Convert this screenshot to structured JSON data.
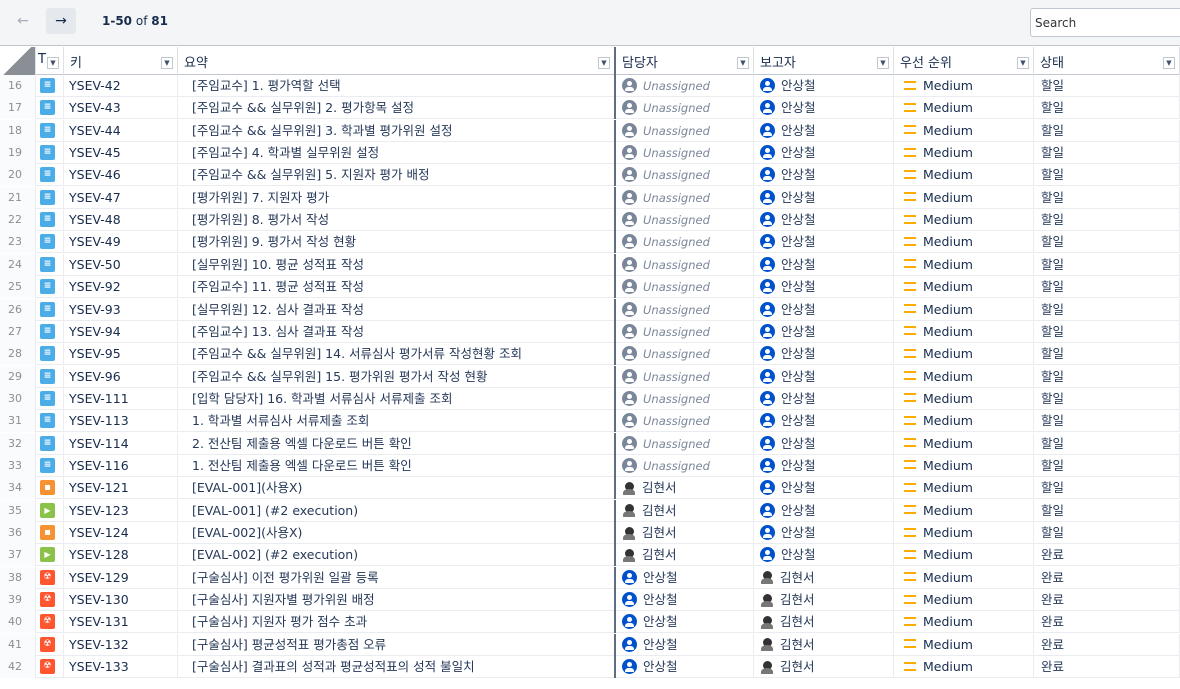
{
  "toolbar": {
    "prev_label": "←",
    "next_label": "→",
    "range": "1-50",
    "of_label": " of ",
    "total": "81",
    "search_placeholder": "Search"
  },
  "columns": {
    "type": "T",
    "key": "키",
    "summary": "요약",
    "assignee": "담당자",
    "reporter": "보고자",
    "priority": "우선 순위",
    "status": "상태"
  },
  "issues": [
    {
      "num": "16",
      "type": "story",
      "key": "YSEV-42",
      "summary": "[주임교수] 1. 평가역할 선택",
      "assignee": "Unassigned",
      "assignee_kind": "unassigned",
      "reporter": "안상철",
      "reporter_kind": "blue",
      "priority": "Medium",
      "status": "할일"
    },
    {
      "num": "17",
      "type": "story",
      "key": "YSEV-43",
      "summary": "[주임교수 && 실무위원] 2. 평가항목 설정",
      "assignee": "Unassigned",
      "assignee_kind": "unassigned",
      "reporter": "안상철",
      "reporter_kind": "blue",
      "priority": "Medium",
      "status": "할일"
    },
    {
      "num": "18",
      "type": "story",
      "key": "YSEV-44",
      "summary": "[주임교수 && 실무위원] 3. 학과별 평가위원 설정",
      "assignee": "Unassigned",
      "assignee_kind": "unassigned",
      "reporter": "안상철",
      "reporter_kind": "blue",
      "priority": "Medium",
      "status": "할일"
    },
    {
      "num": "19",
      "type": "story",
      "key": "YSEV-45",
      "summary": "[주임교수] 4. 학과별 실무위원 설정",
      "assignee": "Unassigned",
      "assignee_kind": "unassigned",
      "reporter": "안상철",
      "reporter_kind": "blue",
      "priority": "Medium",
      "status": "할일"
    },
    {
      "num": "20",
      "type": "story",
      "key": "YSEV-46",
      "summary": "[주임교수 && 실무위원] 5. 지원자 평가 배정",
      "assignee": "Unassigned",
      "assignee_kind": "unassigned",
      "reporter": "안상철",
      "reporter_kind": "blue",
      "priority": "Medium",
      "status": "할일"
    },
    {
      "num": "21",
      "type": "story",
      "key": "YSEV-47",
      "summary": "[평가위원] 7. 지원자 평가",
      "assignee": "Unassigned",
      "assignee_kind": "unassigned",
      "reporter": "안상철",
      "reporter_kind": "blue",
      "priority": "Medium",
      "status": "할일"
    },
    {
      "num": "22",
      "type": "story",
      "key": "YSEV-48",
      "summary": "[평가위원] 8. 평가서 작성",
      "assignee": "Unassigned",
      "assignee_kind": "unassigned",
      "reporter": "안상철",
      "reporter_kind": "blue",
      "priority": "Medium",
      "status": "할일"
    },
    {
      "num": "23",
      "type": "story",
      "key": "YSEV-49",
      "summary": "[평가위원] 9. 평가서 작성 현황",
      "assignee": "Unassigned",
      "assignee_kind": "unassigned",
      "reporter": "안상철",
      "reporter_kind": "blue",
      "priority": "Medium",
      "status": "할일"
    },
    {
      "num": "24",
      "type": "story",
      "key": "YSEV-50",
      "summary": "[실무위원] 10. 평균 성적표 작성",
      "assignee": "Unassigned",
      "assignee_kind": "unassigned",
      "reporter": "안상철",
      "reporter_kind": "blue",
      "priority": "Medium",
      "status": "할일"
    },
    {
      "num": "25",
      "type": "story",
      "key": "YSEV-92",
      "summary": "[주임교수] 11. 평균 성적표 작성",
      "assignee": "Unassigned",
      "assignee_kind": "unassigned",
      "reporter": "안상철",
      "reporter_kind": "blue",
      "priority": "Medium",
      "status": "할일"
    },
    {
      "num": "26",
      "type": "story",
      "key": "YSEV-93",
      "summary": "[실무위원] 12. 심사 결과표 작성",
      "assignee": "Unassigned",
      "assignee_kind": "unassigned",
      "reporter": "안상철",
      "reporter_kind": "blue",
      "priority": "Medium",
      "status": "할일"
    },
    {
      "num": "27",
      "type": "story",
      "key": "YSEV-94",
      "summary": "[주임교수] 13. 심사 결과표 작성",
      "assignee": "Unassigned",
      "assignee_kind": "unassigned",
      "reporter": "안상철",
      "reporter_kind": "blue",
      "priority": "Medium",
      "status": "할일"
    },
    {
      "num": "28",
      "type": "story",
      "key": "YSEV-95",
      "summary": "[주임교수 && 실무위원] 14. 서류심사 평가서류 작성현황 조회",
      "assignee": "Unassigned",
      "assignee_kind": "unassigned",
      "reporter": "안상철",
      "reporter_kind": "blue",
      "priority": "Medium",
      "status": "할일"
    },
    {
      "num": "29",
      "type": "story",
      "key": "YSEV-96",
      "summary": "[주임교수 && 실무위원] 15. 평가위원 평가서 작성 현황",
      "assignee": "Unassigned",
      "assignee_kind": "unassigned",
      "reporter": "안상철",
      "reporter_kind": "blue",
      "priority": "Medium",
      "status": "할일"
    },
    {
      "num": "30",
      "type": "story",
      "key": "YSEV-111",
      "summary": "[입학 담당자] 16. 학과별 서류심사 서류제출 조회",
      "assignee": "Unassigned",
      "assignee_kind": "unassigned",
      "reporter": "안상철",
      "reporter_kind": "blue",
      "priority": "Medium",
      "status": "할일"
    },
    {
      "num": "31",
      "type": "story",
      "key": "YSEV-113",
      "summary": "1. 학과별 서류심사 서류제출 조회",
      "assignee": "Unassigned",
      "assignee_kind": "unassigned",
      "reporter": "안상철",
      "reporter_kind": "blue",
      "priority": "Medium",
      "status": "할일"
    },
    {
      "num": "32",
      "type": "story",
      "key": "YSEV-114",
      "summary": "2. 전산팀 제출용 엑셀 다운로드 버튼 확인",
      "assignee": "Unassigned",
      "assignee_kind": "unassigned",
      "reporter": "안상철",
      "reporter_kind": "blue",
      "priority": "Medium",
      "status": "할일"
    },
    {
      "num": "33",
      "type": "story",
      "key": "YSEV-116",
      "summary": "1. 전산팀 제출용 엑셀 다운로드 버튼 확인",
      "assignee": "Unassigned",
      "assignee_kind": "unassigned",
      "reporter": "안상철",
      "reporter_kind": "blue",
      "priority": "Medium",
      "status": "할일"
    },
    {
      "num": "34",
      "type": "task",
      "key": "YSEV-121",
      "summary": "[EVAL-001](사용X)",
      "assignee": "김현서",
      "assignee_kind": "photo",
      "reporter": "안상철",
      "reporter_kind": "blue",
      "priority": "Medium",
      "status": "할일"
    },
    {
      "num": "35",
      "type": "exec",
      "key": "YSEV-123",
      "summary": "[EVAL-001] (#2 execution)",
      "assignee": "김현서",
      "assignee_kind": "photo",
      "reporter": "안상철",
      "reporter_kind": "blue",
      "priority": "Medium",
      "status": "할일"
    },
    {
      "num": "36",
      "type": "task",
      "key": "YSEV-124",
      "summary": "[EVAL-002](사용X)",
      "assignee": "김현서",
      "assignee_kind": "photo",
      "reporter": "안상철",
      "reporter_kind": "blue",
      "priority": "Medium",
      "status": "할일"
    },
    {
      "num": "37",
      "type": "exec",
      "key": "YSEV-128",
      "summary": "[EVAL-002] (#2 execution)",
      "assignee": "김현서",
      "assignee_kind": "photo",
      "reporter": "안상철",
      "reporter_kind": "blue",
      "priority": "Medium",
      "status": "완료"
    },
    {
      "num": "38",
      "type": "bug",
      "key": "YSEV-129",
      "summary": "[구술심사] 이전 평가위원 일괄 등록",
      "assignee": "안상철",
      "assignee_kind": "blue",
      "reporter": "김현서",
      "reporter_kind": "photo",
      "priority": "Medium",
      "status": "완료"
    },
    {
      "num": "39",
      "type": "bug",
      "key": "YSEV-130",
      "summary": "[구술심사] 지원자별 평가위원 배정",
      "assignee": "안상철",
      "assignee_kind": "blue",
      "reporter": "김현서",
      "reporter_kind": "photo",
      "priority": "Medium",
      "status": "완료"
    },
    {
      "num": "40",
      "type": "bug",
      "key": "YSEV-131",
      "summary": "[구술심사] 지원자 평가 점수 초과",
      "assignee": "안상철",
      "assignee_kind": "blue",
      "reporter": "김현서",
      "reporter_kind": "photo",
      "priority": "Medium",
      "status": "완료"
    },
    {
      "num": "41",
      "type": "bug",
      "key": "YSEV-132",
      "summary": "[구술심사] 평균성적표 평가총점 오류",
      "assignee": "안상철",
      "assignee_kind": "blue",
      "reporter": "김현서",
      "reporter_kind": "photo",
      "priority": "Medium",
      "status": "완료"
    },
    {
      "num": "42",
      "type": "bug",
      "key": "YSEV-133",
      "summary": "[구술심사] 결과표의 성적과 평균성적표의 성적 불일치",
      "assignee": "안상철",
      "assignee_kind": "blue",
      "reporter": "김현서",
      "reporter_kind": "photo",
      "priority": "Medium",
      "status": "완료"
    }
  ],
  "colors": {
    "story": "#4bade8",
    "task": "#f79232",
    "execution": "#8bc34a",
    "bug": "#ff5630",
    "priority_medium": "#ffab00",
    "avatar_blue": "#0052cc"
  },
  "icons": {
    "story": "story-icon",
    "task": "task-icon",
    "exec": "test-execution-icon",
    "bug": "bug-icon",
    "priority": "priority-medium-icon"
  }
}
